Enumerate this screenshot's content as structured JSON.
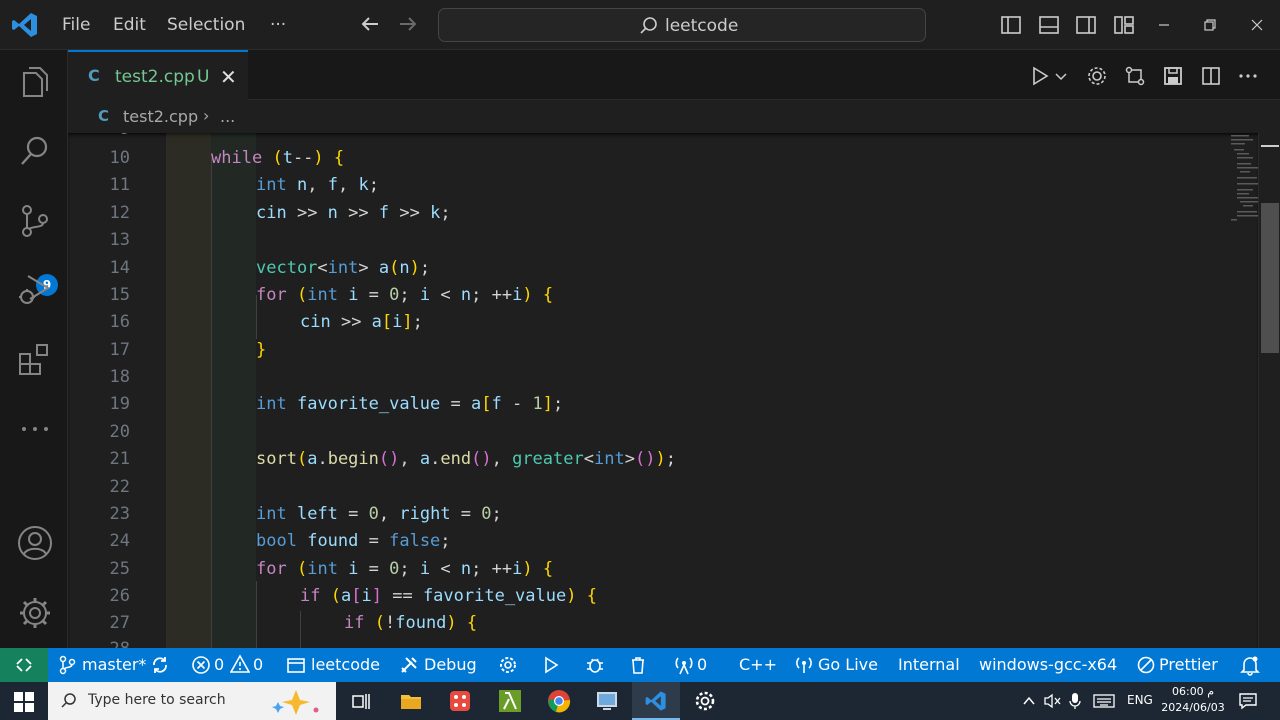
{
  "titlebar": {
    "menu": [
      "File",
      "Edit",
      "Selection",
      "···"
    ],
    "search": "leetcode"
  },
  "tab": {
    "icon": "C",
    "label": "test2.cpp",
    "status": "U",
    "close": "✕"
  },
  "breadcrumb": {
    "file": "test2.cpp",
    "sep": "›",
    "more": "..."
  },
  "activity": {
    "scm_badge": "9"
  },
  "editor": {
    "line_numbers": [
      "10",
      "11",
      "12",
      "13",
      "14",
      "15",
      "16",
      "17",
      "18",
      "19",
      "20",
      "21",
      "22",
      "23",
      "24",
      "25",
      "26",
      "27"
    ],
    "lines": [
      "while (t--) {",
      "int n, f, k;",
      "cin >> n >> f >> k;",
      "",
      "vector<int> a(n);",
      "for (int i = 0; i < n; ++i) {",
      "cin >> a[i];",
      "}",
      "",
      "int favorite_value = a[f - 1];",
      "",
      "sort(a.begin(), a.end(), greater<int>());",
      "",
      "int left = 0, right = 0;",
      "bool found = false;",
      "for (int i = 0; i < n; ++i) {",
      "if (a[i] == favorite_value) {",
      "if (!found) {"
    ],
    "partial_top": "9",
    "partial_bottom": "28"
  },
  "statusbar": {
    "branch": "master*",
    "errors": "0",
    "warnings": "0",
    "folder": "leetcode",
    "debug": "Debug",
    "ports": "0",
    "language": "C++",
    "golive": "Go Live",
    "internal": "Internal",
    "compiler": "windows-gcc-x64",
    "prettier": "Prettier"
  },
  "taskbar": {
    "search_placeholder": "Type here to search",
    "language": "ENG",
    "time": "06:00 م",
    "date": "2024/06/03"
  },
  "colors": {
    "accent": "#0078d4",
    "remote": "#16825d",
    "editor_bg": "#1f1f1f"
  }
}
